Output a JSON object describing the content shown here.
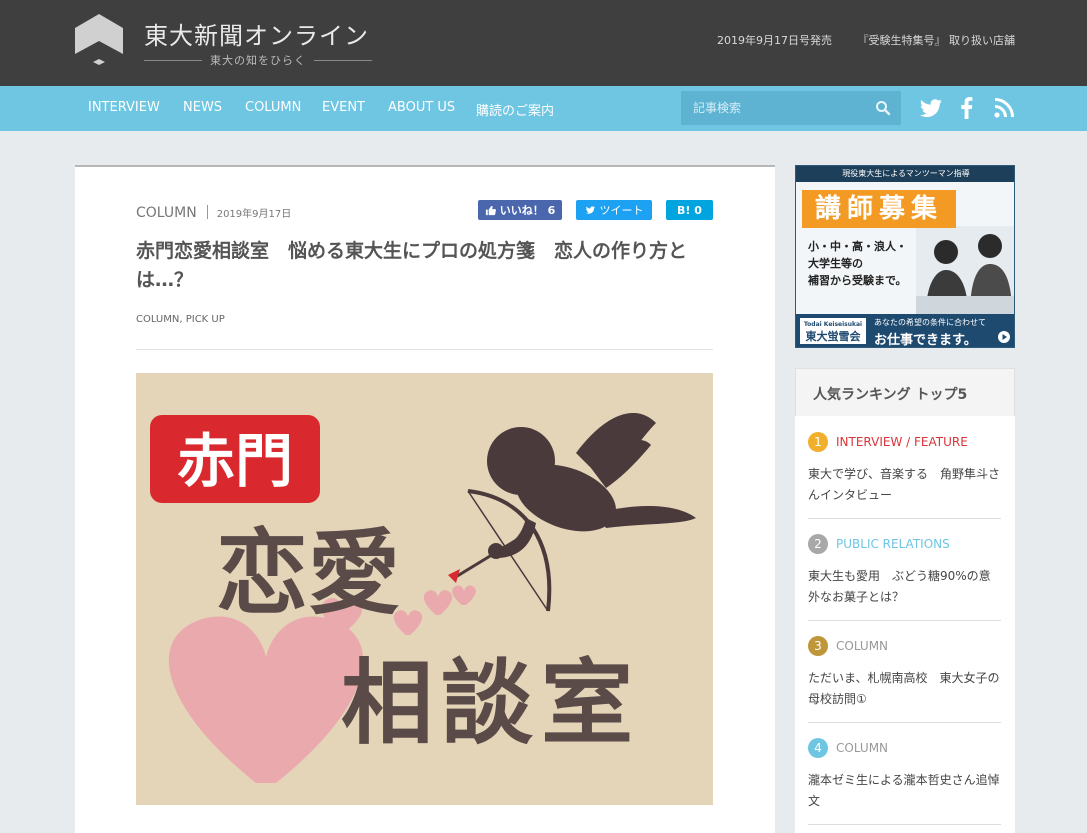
{
  "header": {
    "site_title": "東大新聞オンライン",
    "tagline": "東大の知をひらく",
    "issue": "2019年9月17日号発売",
    "special": "『受験生特集号』 取り扱い店舗"
  },
  "nav": {
    "items": [
      {
        "label": "INTERVIEW"
      },
      {
        "label": "NEWS"
      },
      {
        "label": "COLUMN"
      },
      {
        "label": "EVENT"
      },
      {
        "label": "ABOUT US"
      },
      {
        "label": "購読のご案内"
      }
    ],
    "search_placeholder": "記事検索"
  },
  "article": {
    "category": "COLUMN",
    "date": "2019年9月17日",
    "share": {
      "like": "いいね！ 6",
      "tweet": "ツイート",
      "hatena": "B! 0"
    },
    "title": "赤門恋愛相談室　悩める東大生にプロの処方箋　恋人の作り方とは…？",
    "tags": "COLUMN, PICK UP",
    "hero": {
      "badge": "赤門",
      "line1": "恋愛",
      "line2": "相談室"
    }
  },
  "ad": {
    "top": "現役東大生によるマンツーマン指導",
    "headline": "講師募集",
    "copy": [
      "小・中・高・浪人・",
      "大学生等の",
      "補習から受験まで。"
    ],
    "brand_en": "Todai Keiseisukai",
    "brand_jp": "東大蛍雪会",
    "sub": "あなたの希望の条件に合わせて",
    "main": "お仕事できます。"
  },
  "ranking": {
    "title": "人気ランキング トップ5",
    "items": [
      {
        "num": "1",
        "category": "INTERVIEW / FEATURE",
        "title": "東大で学び、音楽する　角野隼斗さんインタビュー",
        "color": "#f0b02c",
        "cat_color": "#d9343a"
      },
      {
        "num": "2",
        "category": "PUBLIC RELATIONS",
        "title": "東大生も愛用　ぶどう糖90%の意外なお菓子とは？",
        "color": "#a8a8a8",
        "cat_color": "#6ec6e3"
      },
      {
        "num": "3",
        "category": "COLUMN",
        "title": "ただいま、札幌南高校　東大女子の母校訪問①",
        "color": "#c0963a",
        "cat_color": "#999999"
      },
      {
        "num": "4",
        "category": "COLUMN",
        "title": "瀧本ゼミ生による瀧本哲史さん追悼文",
        "color": "#6ec6e3",
        "cat_color": "#999999"
      }
    ]
  },
  "colors": {
    "header": "#3f3f3f",
    "nav": "#6ec6e3",
    "background": "#e7ebee"
  }
}
